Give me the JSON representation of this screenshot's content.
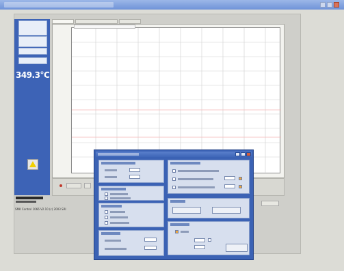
{
  "window": {
    "title": "",
    "tabs": [
      "",
      "",
      ""
    ]
  },
  "sidebar": {
    "readout": "349.3°C"
  },
  "chart": {
    "y_ticks": [
      "",
      "",
      "",
      "",
      "",
      "",
      "",
      "",
      "",
      "",
      ""
    ]
  },
  "status": {
    "text": "SMK Control 1066 V2.10 (c) 2003 SRI"
  },
  "dialog": {
    "title": "",
    "groups": [
      "",
      "",
      "",
      "",
      "",
      "",
      ""
    ],
    "ok_label": ""
  },
  "colors": {
    "sidebar": "#3d63b6",
    "dialog": "#3b62b4",
    "titlebar": "#6f93d8",
    "gridline": "#cfcfcf",
    "redline": "#f4b5b5"
  },
  "icons": [
    "warning-icon",
    "minimize-icon",
    "maximize-icon",
    "close-icon"
  ]
}
